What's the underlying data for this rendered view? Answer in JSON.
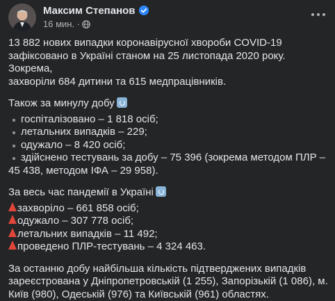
{
  "author": {
    "name": "Максим Степанов",
    "time": "16 мин."
  },
  "colors": {
    "background": "#242526",
    "text": "#e4e6eb",
    "muted": "#b0b3b8",
    "verified": "#2d88ff",
    "triangle": "#e2463a"
  },
  "post": {
    "intro": [
      "13 882 нових випадки коронавірусної хвороби COVID-19",
      "зафіксовано в Україні станом на 25 листопада 2020 року. Зокрема,",
      "захворіли 684 дитини та 615 медпрацівників."
    ],
    "last_day_heading": "Також за минулу добу",
    "last_day_items": [
      [
        "госпіталізовано – 1 818 осіб;"
      ],
      [
        "летальних випадків – 229;"
      ],
      [
        "одужало – 8 420 осіб;"
      ],
      [
        "здійснено тестувань за добу – 75 396 (зокрема методом ПЛР –",
        "45 438, методом ІФА – 29 958)."
      ]
    ],
    "pandemic_heading": "За весь час пандемії в Україні",
    "pandemic_items": [
      "захворіло – 661 858 осіб;",
      "одужало – 307 778 осіб;",
      "летальних випадків – 11 492;",
      "проведено ПЛР-тестувань – 4 324 463."
    ],
    "outro": [
      "За останню добу найбільша кількість підтверджених випадків",
      "зареєстрована у  Дніпропетровській (1 255), Запорізькій (1 086), м.",
      "Київ (980), Одеській (976) та Київській (961) областях."
    ]
  }
}
